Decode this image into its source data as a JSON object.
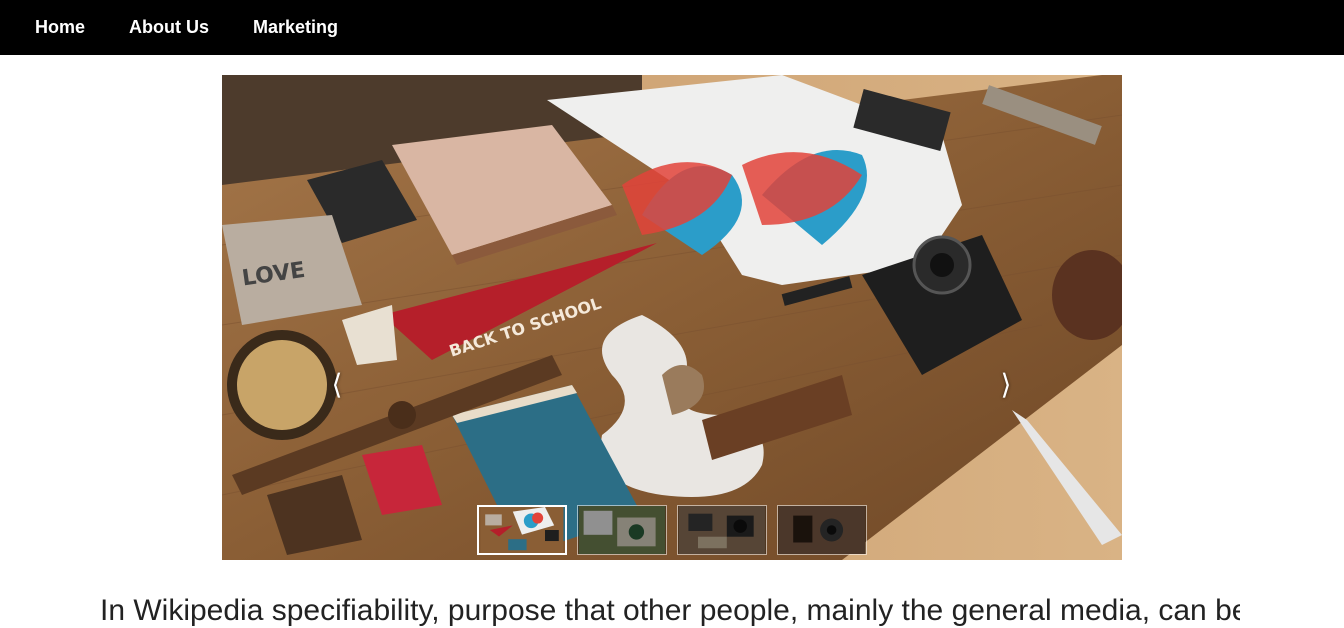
{
  "nav": {
    "items": [
      {
        "label": "Home"
      },
      {
        "label": "About Us"
      },
      {
        "label": "Marketing"
      }
    ]
  },
  "slider": {
    "prev_icon": "chevron-left-icon",
    "next_icon": "chevron-right-icon",
    "prev_glyph": "⟨",
    "next_glyph": "⟩",
    "slide_count": 4,
    "active_slide": 1
  },
  "body_text": "In Wikipedia specifiability, purpose that other people, mainly the general media, can be done"
}
